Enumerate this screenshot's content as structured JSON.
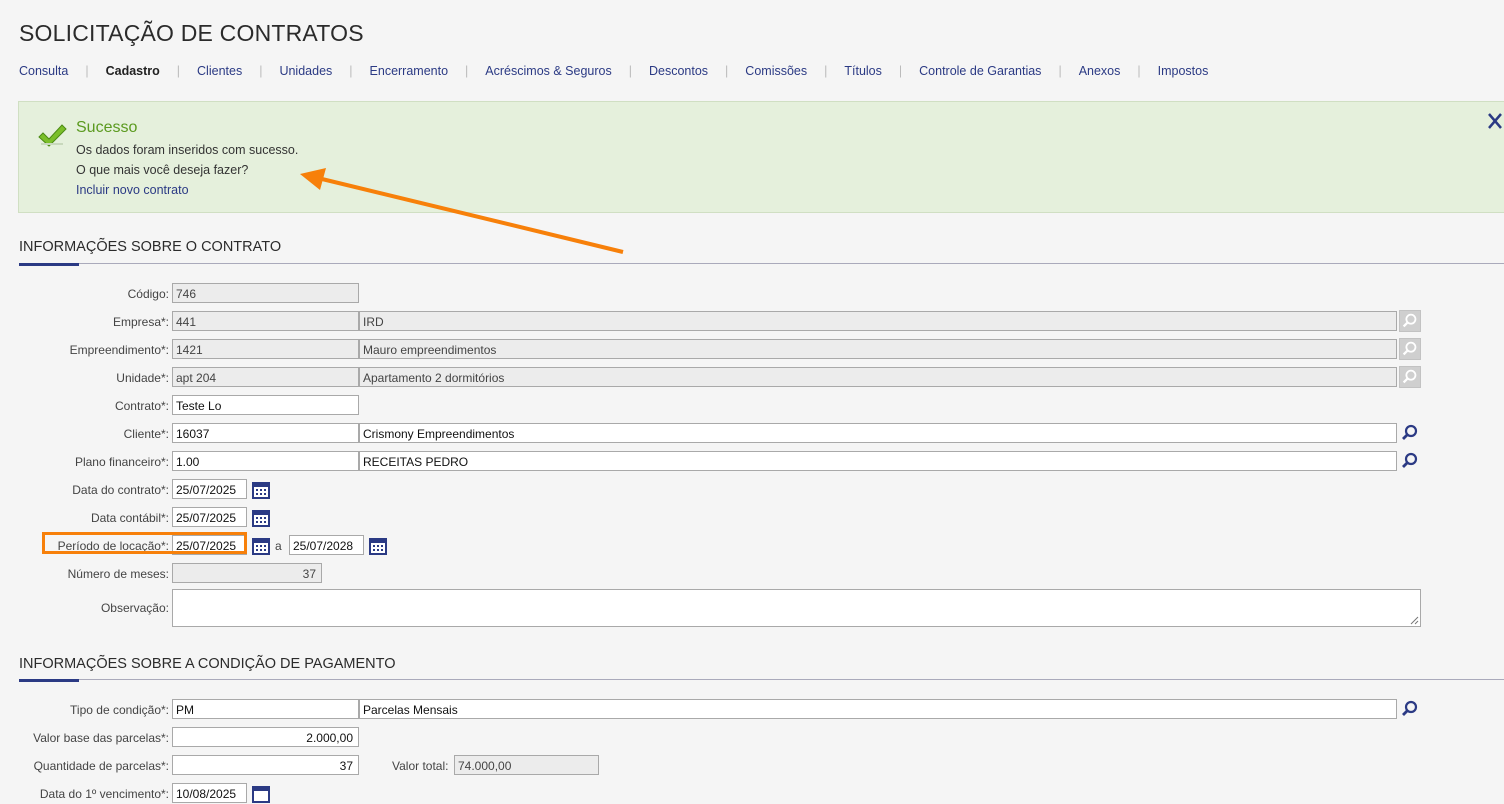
{
  "page": {
    "title": "SOLICITAÇÃO DE CONTRATOS"
  },
  "nav": {
    "tabs": [
      "Consulta",
      "Cadastro",
      "Clientes",
      "Unidades",
      "Encerramento",
      "Acréscimos & Seguros",
      "Descontos",
      "Comissões",
      "Títulos",
      "Controle de Garantias",
      "Anexos",
      "Impostos"
    ],
    "active": "Cadastro"
  },
  "alert": {
    "title": "Sucesso",
    "message": "Os dados foram inseridos com sucesso.",
    "question": "O que mais você deseja fazer?",
    "link": "Incluir novo contrato"
  },
  "contract_section": {
    "title": "INFORMAÇÕES SOBRE O CONTRATO",
    "codigo": {
      "label": "Código:",
      "value": "746"
    },
    "empresa": {
      "label": "Empresa*:",
      "code": "441",
      "name": "IRD"
    },
    "empreendimento": {
      "label": "Empreendimento*:",
      "code": "1421",
      "name": "Mauro empreendimentos"
    },
    "unidade": {
      "label": "Unidade*:",
      "code": "apt 204",
      "name": "Apartamento 2 dormitórios"
    },
    "contrato": {
      "label": "Contrato*:",
      "value": "Teste Lo"
    },
    "cliente": {
      "label": "Cliente*:",
      "code": "16037",
      "name": "Crismony Empreendimentos"
    },
    "plano": {
      "label": "Plano financeiro*:",
      "code": "1.00",
      "name": "RECEITAS PEDRO"
    },
    "data_contrato": {
      "label": "Data do contrato*:",
      "value": "25/07/2025"
    },
    "data_contabil": {
      "label": "Data contábil*:",
      "value": "25/07/2025"
    },
    "periodo": {
      "label": "Período de locação*:",
      "start": "25/07/2025",
      "separator": "a",
      "end": "25/07/2028"
    },
    "meses": {
      "label": "Número de meses:",
      "value": "37"
    },
    "observacao": {
      "label": "Observação:",
      "value": ""
    }
  },
  "payment_section": {
    "title": "INFORMAÇÕES SOBRE A CONDIÇÃO DE PAGAMENTO",
    "tipo": {
      "label": "Tipo de condição*:",
      "code": "PM",
      "name": "Parcelas Mensais"
    },
    "valor_base": {
      "label": "Valor base das parcelas*:",
      "value": "2.000,00"
    },
    "quantidade": {
      "label": "Quantidade de parcelas*:",
      "value": "37"
    },
    "valor_total": {
      "label": "Valor total:",
      "value": "74.000,00"
    },
    "primeiro_venc": {
      "label": "Data do 1º vencimento*:",
      "value": "10/08/2025"
    }
  },
  "colors": {
    "accent": "#2b3a84",
    "success": "#5b9a1f",
    "annotation": "#f7800a"
  },
  "icons": [
    "check-icon",
    "close-icon",
    "search-icon",
    "calendar-icon"
  ]
}
